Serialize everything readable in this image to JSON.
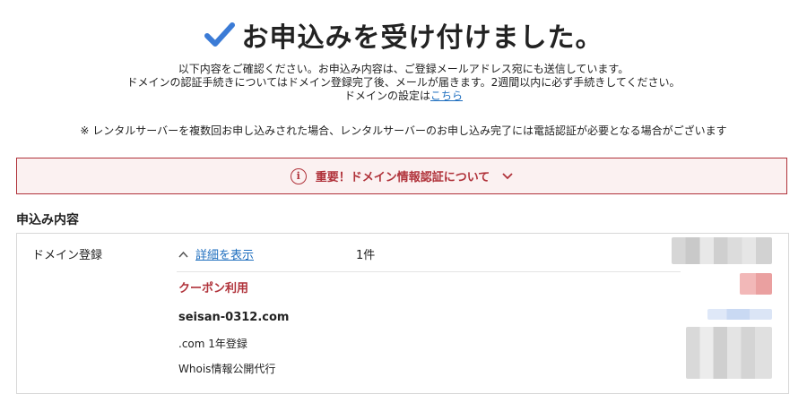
{
  "header": {
    "title": "お申込みを受け付けました。",
    "check_icon": "check-icon",
    "accent_color": "#3b7bd6"
  },
  "info": {
    "line1": "以下内容をご確認ください。お申込み内容は、ご登録メールアドレス宛にも送信しています。",
    "line2": "ドメインの認証手続きについてはドメイン登録完了後、メールが届きます。2週間以内に必ず手続きしてください。",
    "line3_prefix": "ドメインの設定は",
    "line3_link": "こちら"
  },
  "note": "※ レンタルサーバーを複数回お申し込みされた場合、レンタルサーバーのお申し込み完了には電話認証が必要となる場合がございます",
  "alert": {
    "icon": "i",
    "text": "重要！ドメイン情報認証について",
    "color": "#b0323a",
    "background": "#fbf1f1"
  },
  "section": {
    "title": "申込み内容"
  },
  "order": {
    "row_label": "ドメイン登録",
    "details_link": "詳細を表示",
    "count": "1件",
    "coupon_label": "クーポン利用",
    "domain_name": "seisan-0312.com",
    "plan": ".com 1年登録",
    "whois": "Whois情報公開代行"
  },
  "colors": {
    "link": "#1f6fbf",
    "alert_red": "#b0323a"
  }
}
